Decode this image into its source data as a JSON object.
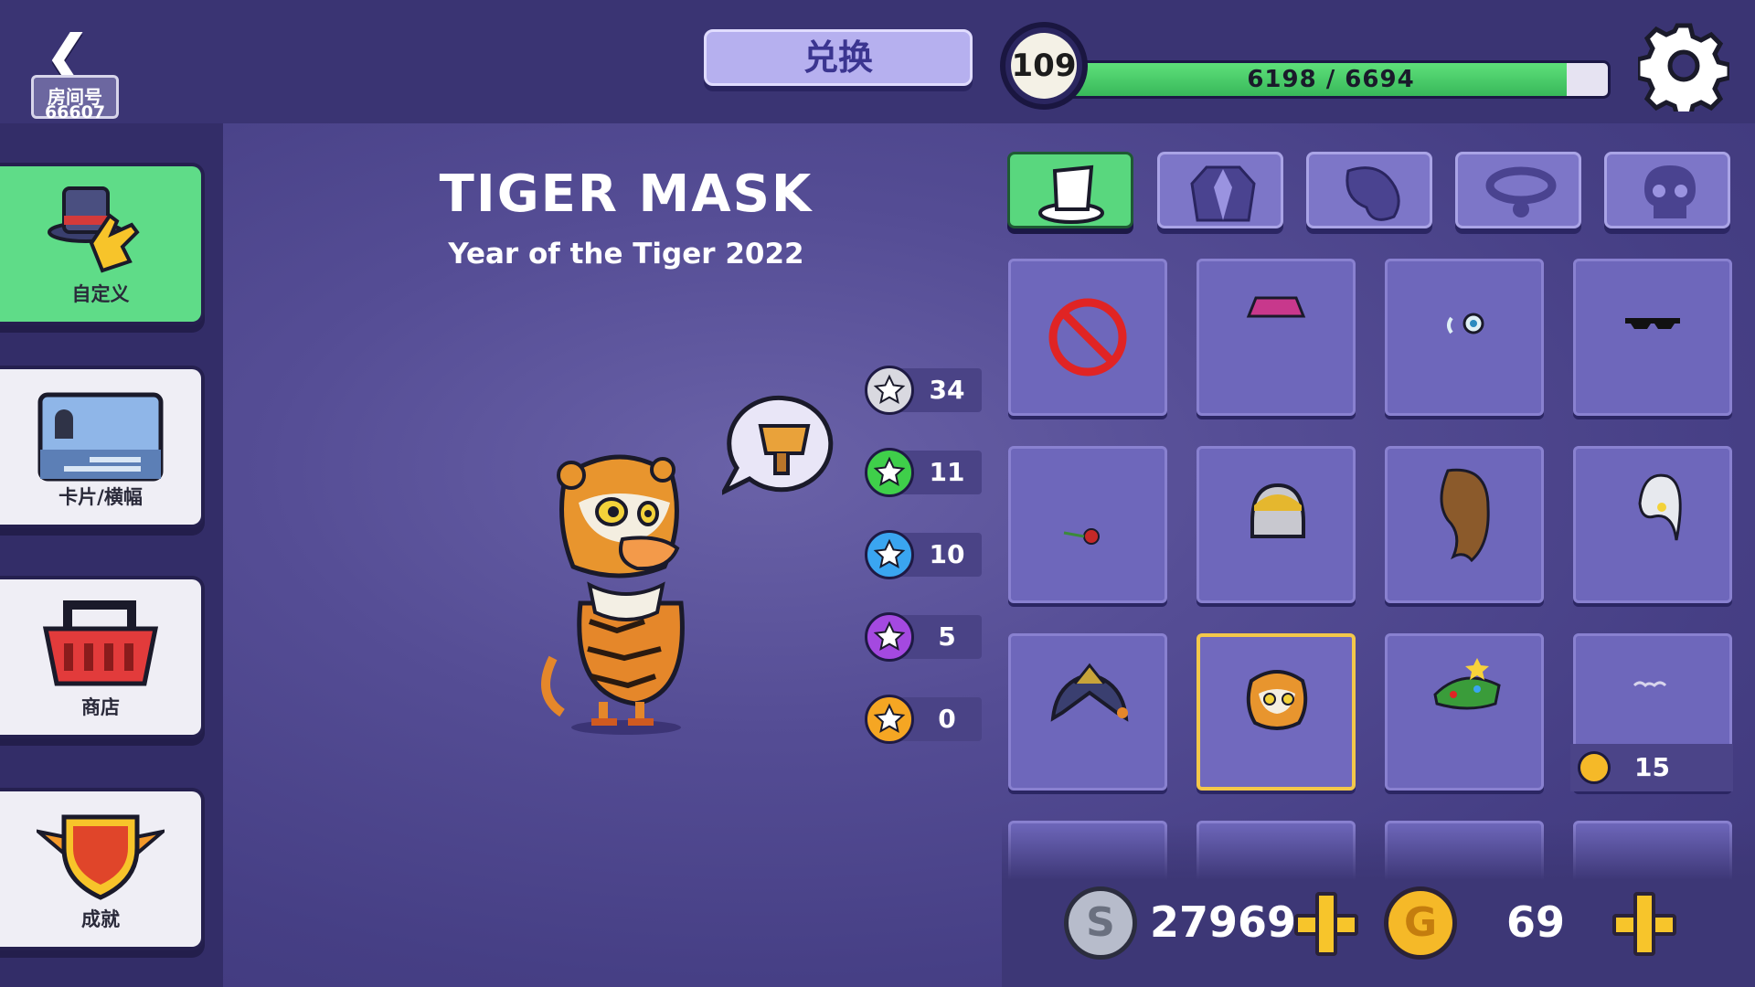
{
  "header": {
    "room_label": "房间号",
    "room_id": "66607",
    "redeem_label": "兑换",
    "level": "109",
    "xp_text": "6198 / 6694",
    "xp_progress": 0.926
  },
  "sidebar": {
    "items": [
      {
        "label": "自定义",
        "active": true
      },
      {
        "label": "卡片/横幅",
        "active": false
      },
      {
        "label": "商店",
        "active": false
      },
      {
        "label": "成就",
        "active": false
      }
    ]
  },
  "item": {
    "title": "TIGER MASK",
    "subtitle": "Year of the Tiger 2022"
  },
  "star_currency": [
    {
      "color": "#d9d9e0",
      "value": "34"
    },
    {
      "color": "#3fcf4a",
      "value": "11"
    },
    {
      "color": "#3aa5f0",
      "value": "10"
    },
    {
      "color": "#a449e0",
      "value": "5"
    },
    {
      "color": "#f5a623",
      "value": "0"
    }
  ],
  "categories": [
    {
      "icon": "top-hat-icon",
      "active": true
    },
    {
      "icon": "jacket-icon",
      "active": false
    },
    {
      "icon": "hair-icon",
      "active": false
    },
    {
      "icon": "collar-icon",
      "active": false
    },
    {
      "icon": "skull-icon",
      "active": false
    }
  ],
  "grid_items": [
    {
      "icon": "none-icon"
    },
    {
      "icon": "bucket-hat-icon"
    },
    {
      "icon": "eyes-icon"
    },
    {
      "icon": "sunglasses-icon"
    },
    {
      "icon": "rose-icon"
    },
    {
      "icon": "helmet-icon"
    },
    {
      "icon": "brown-hair-icon"
    },
    {
      "icon": "white-hair-icon"
    },
    {
      "icon": "crown-headpiece-icon"
    },
    {
      "icon": "tiger-mask-icon",
      "selected": true
    },
    {
      "icon": "christmas-tree-hat-icon"
    },
    {
      "icon": "glasses-icon",
      "price": "15"
    }
  ],
  "wallet": {
    "silver": "27969",
    "silver_symbol": "S",
    "gold": "69",
    "gold_symbol": "G"
  }
}
